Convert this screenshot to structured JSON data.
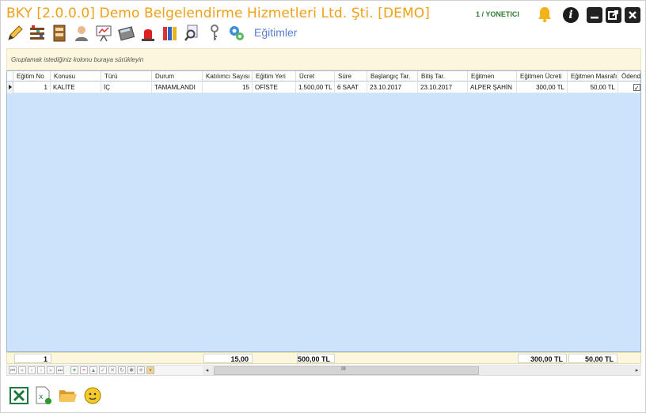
{
  "window": {
    "title": "BKY [2.0.0.0] Demo Belgelendirme Hizmetleri Ltd. Şti. [DEMO]",
    "user": "1 / YONETICI"
  },
  "toolbar": {
    "icons": [
      "pencil-icon",
      "shelf-icon",
      "cabinet-icon",
      "user-icon",
      "presentation-icon",
      "calculator-icon",
      "alarm-icon",
      "books-icon",
      "search-icon",
      "key-icon",
      "settings-icon"
    ]
  },
  "section_title": "Eğitimler",
  "group_panel": {
    "hint": "Gruplamak istediğiniz kolonu buraya sürükleyin"
  },
  "grid": {
    "columns": [
      "Eğitim No",
      "Konusu",
      "Türü",
      "Durum",
      "Katılımcı Sayısı",
      "Eğitim Yeri",
      "Ücret",
      "Süre",
      "Başlangıç Tar.",
      "Bitiş Tar.",
      "Eğitmen",
      "Eğitmen Ücreti",
      "Eğitmen Masrafı",
      "Ödendi"
    ],
    "rows": [
      {
        "no": "1",
        "konusu": "KALİTE",
        "turu": "İÇ",
        "durum": "TAMAMLANDI",
        "katilimci": "15",
        "yer": "OFİSTE",
        "ucret": "1.500,00 TL",
        "sure": "6 SAAT",
        "baslangic": "23.10.2017",
        "bitis": "23.10.2017",
        "egitmen": "ALPER ŞAHİN",
        "egitmen_ucreti": "300,00 TL",
        "egitmen_masrafi": "50,00 TL",
        "odendi": true
      }
    ]
  },
  "footer": {
    "count": "1",
    "katilimci_total": "15,00",
    "ucret_total": "500,00 TL",
    "egitmen_ucreti_total": "300,00 TL",
    "egitmen_masrafi_total": "50,00 TL"
  },
  "navigator": {
    "scroll_mark": "III"
  },
  "bottom_tools": {
    "icons": [
      "excel-icon",
      "excel-export-icon",
      "folder-icon",
      "support-icon"
    ]
  },
  "colors": {
    "title": "#f0a018",
    "user": "#2e7d32",
    "grid_background": "#cce4fb",
    "group_panel": "#fbf7dc",
    "section_title": "#5a7ed0"
  }
}
